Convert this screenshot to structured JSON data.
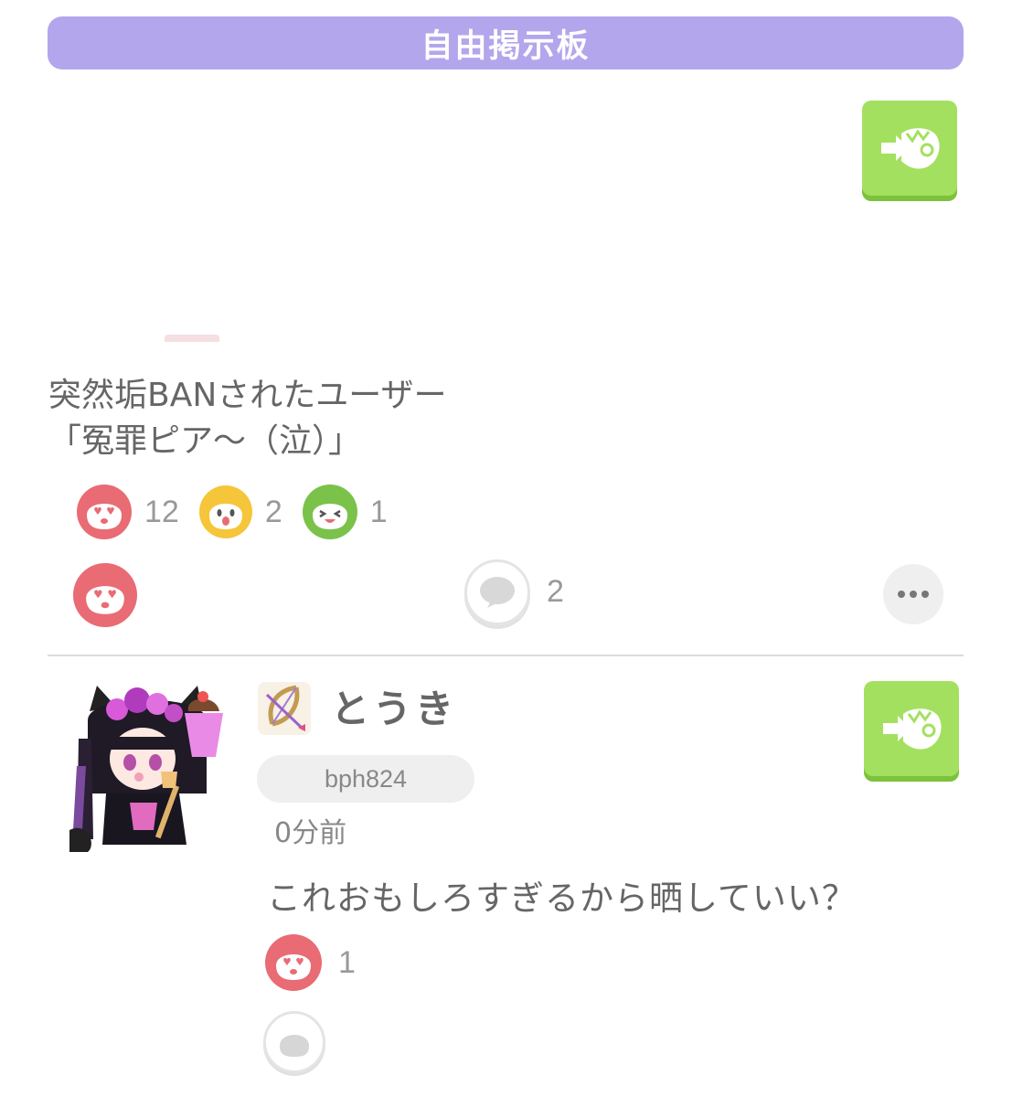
{
  "header": {
    "title": "自由掲示板"
  },
  "post": {
    "text_line1": "突然垢BANされたユーザー",
    "text_line2": "「冤罪ピア～（泣）」",
    "reactions": [
      {
        "icon": "heart-eyes-face-icon",
        "color": "#e96b74",
        "count": "12"
      },
      {
        "icon": "shocked-face-icon",
        "color": "#f5c53a",
        "count": "2"
      },
      {
        "icon": "laughing-face-icon",
        "color": "#7bc24a",
        "count": "1"
      }
    ],
    "comment_count": "2"
  },
  "comment": {
    "username": "とうき",
    "user_id": "bph824",
    "timestamp": "0分前",
    "text": "これおもしろすぎるから晒していい？",
    "reaction_count": "1"
  },
  "colors": {
    "header_bg": "#b3a6ec",
    "share_button": "#a4e060",
    "heart_reaction": "#e96b74"
  }
}
